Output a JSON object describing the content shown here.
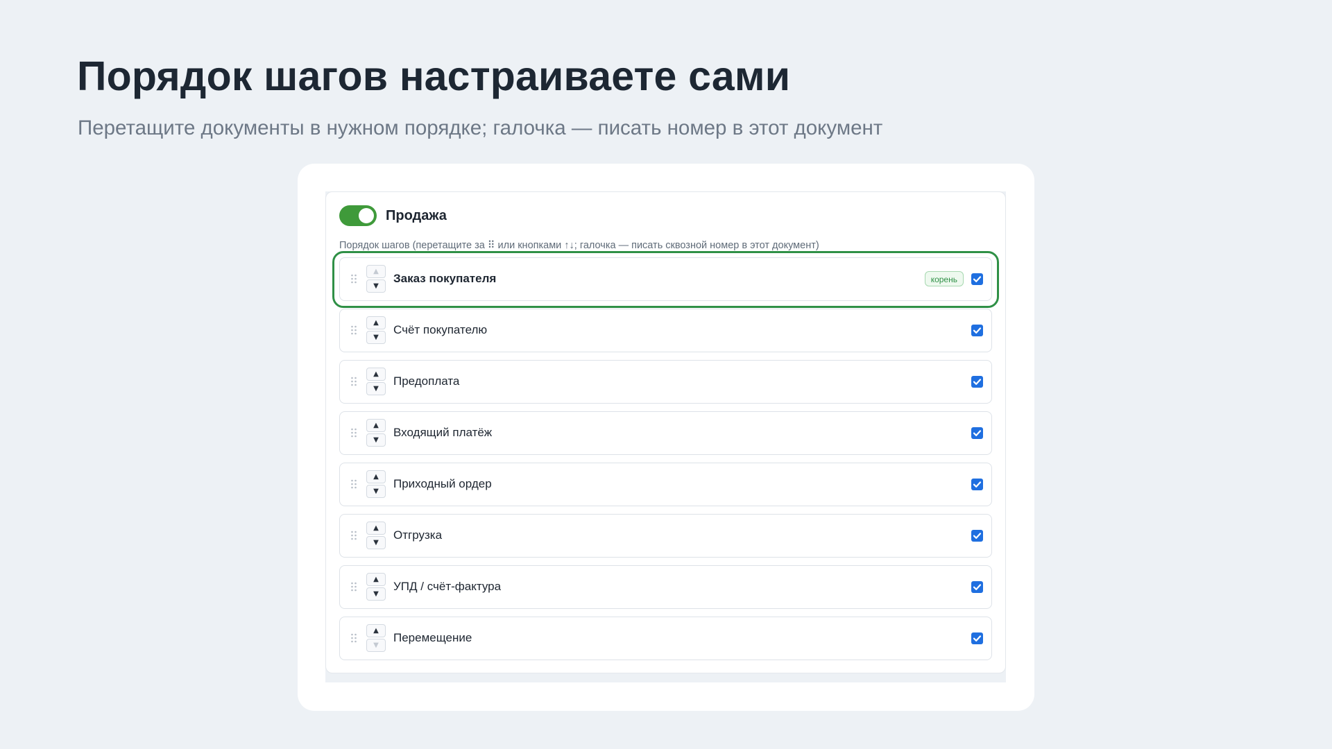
{
  "page": {
    "title": "Порядок шагов настраиваете сами",
    "subtitle": "Перетащите документы в нужном порядке; галочка — писать номер в этот документ"
  },
  "section": {
    "title": "Продажа",
    "enabled": true,
    "hint": "Порядок шагов (перетащите за ⠿ или кнопками ↑↓; галочка — писать сквозной номер в этот документ)"
  },
  "controls": {
    "up_arrow": "▲",
    "down_arrow": "▼"
  },
  "steps": [
    {
      "name": "Заказ покупателя",
      "badge": "корень",
      "checked": true,
      "highlighted": true
    },
    {
      "name": "Счёт покупателю",
      "checked": true
    },
    {
      "name": "Предоплата",
      "checked": true
    },
    {
      "name": "Входящий платёж",
      "checked": true
    },
    {
      "name": "Приходный ордер",
      "checked": true
    },
    {
      "name": "Отгрузка",
      "checked": true
    },
    {
      "name": "УПД / счёт-фактура",
      "checked": true
    },
    {
      "name": "Перемещение",
      "checked": true
    }
  ],
  "colors": {
    "toggle_on": "#3f9a3a",
    "highlight": "#2f9046",
    "checkbox": "#1f6fe0"
  },
  "icons": {
    "drag": "drag-handle-icon",
    "check": "checkmark-icon"
  }
}
